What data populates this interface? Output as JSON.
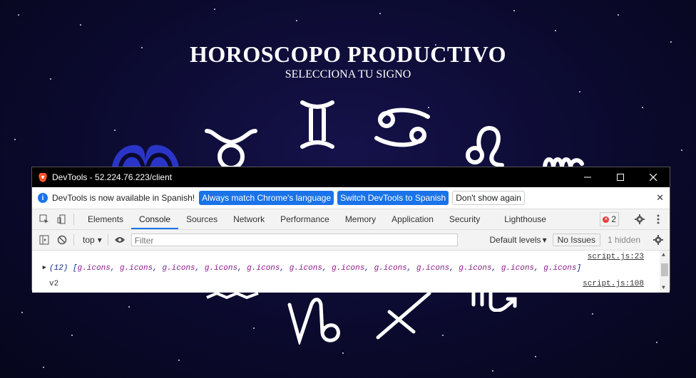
{
  "page": {
    "title": "HOROSCOPO PRODUCTIVO",
    "subtitle": "SELECCIONA TU SIGNO"
  },
  "devtools": {
    "window_title": "DevTools - 52.224.76.223/client",
    "infobar": {
      "message": "DevTools is now available in Spanish!",
      "btn_match": "Always match Chrome's language",
      "btn_switch": "Switch DevTools to Spanish",
      "btn_dont_show": "Don't show again"
    },
    "tabs": [
      "Elements",
      "Console",
      "Sources",
      "Network",
      "Performance",
      "Memory",
      "Application",
      "Security",
      "Lighthouse"
    ],
    "active_tab": "Console",
    "error_count": "2",
    "context": "top",
    "filter_placeholder": "Filter",
    "default_levels": "Default levels",
    "no_issues": "No Issues",
    "hidden": "1 hidden",
    "logs": [
      {
        "source": "script.js:23",
        "count": "(12)",
        "items": [
          "g.icons",
          "g.icons",
          "g.icons",
          "g.icons",
          "g.icons",
          "g.icons",
          "g.icons",
          "g.icons",
          "g.icons",
          "g.icons",
          "g.icons",
          "g.icons"
        ]
      },
      {
        "text": "v2",
        "source": "script.js:108"
      }
    ]
  },
  "icons": {
    "zodiac": [
      "aries-icon",
      "taurus-icon",
      "gemini-icon",
      "cancer-icon",
      "leo-icon",
      "virgo-icon",
      "aquarius-icon",
      "capricorn-icon",
      "sagittarius-icon",
      "scorpio-icon"
    ]
  },
  "colors": {
    "background": "#0b0a2e",
    "accent_blue": "#1a73e8",
    "aries_fill": "#2a35c8"
  }
}
